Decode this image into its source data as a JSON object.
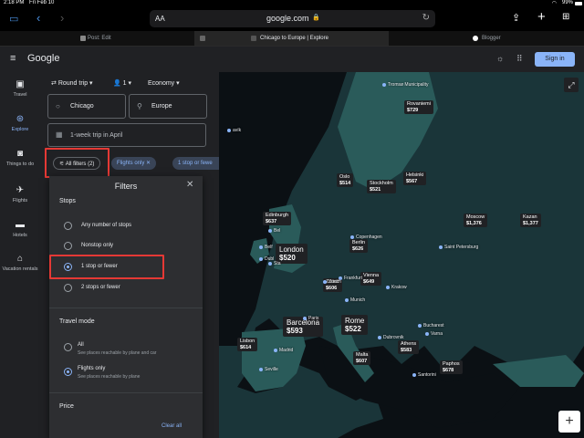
{
  "status": {
    "time": "2:18 PM",
    "date": "Fri Feb 10",
    "battery": "99%"
  },
  "browser": {
    "text_size": "AA",
    "url": "google.com"
  },
  "tabs": [
    {
      "label": "Post: Edit"
    },
    {
      "label": "Chicago to Europe | Explore"
    },
    {
      "label": "Blogger"
    }
  ],
  "header": {
    "logo": "Google",
    "signin": "Sign in"
  },
  "sidebar": [
    {
      "label": "Travel"
    },
    {
      "label": "Explore"
    },
    {
      "label": "Things to do"
    },
    {
      "label": "Flights"
    },
    {
      "label": "Hotels"
    },
    {
      "label": "Vacation rentals"
    }
  ],
  "search": {
    "trip_type": "Round trip",
    "passengers": "1",
    "cabin": "Economy",
    "origin": "Chicago",
    "destination": "Europe",
    "dates": "1-week trip in April"
  },
  "chips": {
    "all_filters": "All filters (2)",
    "flights_only": "Flights only",
    "stops": "1 stop or fewe"
  },
  "filters": {
    "title": "Filters",
    "stops_heading": "Stops",
    "stops_options": [
      "Any number of stops",
      "Nonstop only",
      "1 stop or fewer",
      "2 stops or fewer"
    ],
    "selected_stop": "1 stop or fewer",
    "travel_heading": "Travel mode",
    "travel_options": [
      {
        "label": "All",
        "sub": "See places reachable by plane and car"
      },
      {
        "label": "Flights only",
        "sub": "See places reachable by plane"
      }
    ],
    "price_heading": "Price",
    "clear": "Clear all"
  },
  "map": {
    "region_labels": [
      "Tromsø Municipality",
      "Copenhagen",
      "Saint Petersburg",
      "Frankfurt",
      "Munich",
      "Krakow",
      "Paris",
      "Bucharest",
      "Varna",
      "Madrid",
      "Seville",
      "Dubrovnik",
      "Santorini",
      "Belf",
      "Dubl",
      "Zürich",
      "Bel",
      "Sta",
      "avík"
    ],
    "pins": [
      {
        "city": "Rovaniemi",
        "price": "$729"
      },
      {
        "city": "Oslo",
        "price": "$514"
      },
      {
        "city": "Stockholm",
        "price": "$521"
      },
      {
        "city": "Helsinki",
        "price": "$567"
      },
      {
        "city": "Edinburgh",
        "price": "$637"
      },
      {
        "city": "Moscow",
        "price": "$1,376"
      },
      {
        "city": "Kazan",
        "price": "$1,377"
      },
      {
        "city": "Berlin",
        "price": "$626"
      },
      {
        "city": "London",
        "price": "$520"
      },
      {
        "city": "Zürich",
        "price": "$606"
      },
      {
        "city": "Vienna",
        "price": "$649"
      },
      {
        "city": "Barcelona",
        "price": "$593"
      },
      {
        "city": "Rome",
        "price": "$522"
      },
      {
        "city": "Lisbon",
        "price": "$614"
      },
      {
        "city": "Athens",
        "price": "$583"
      },
      {
        "city": "Malta",
        "price": "$607"
      },
      {
        "city": "Paphos",
        "price": "$678"
      }
    ],
    "zoom_in": "+"
  }
}
